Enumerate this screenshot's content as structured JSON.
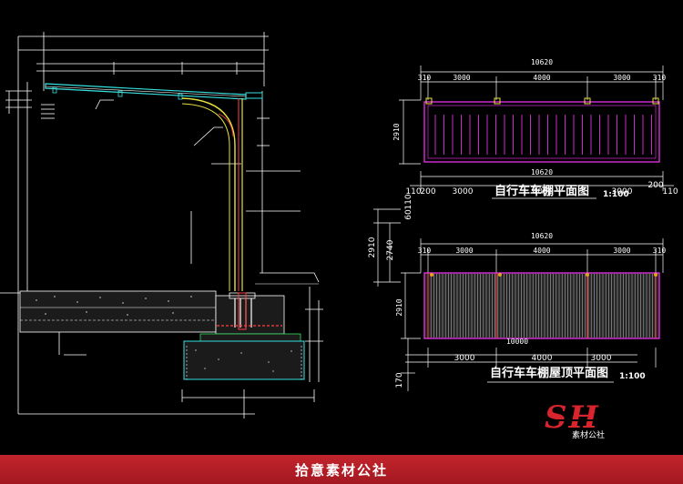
{
  "plan_view": {
    "title": "自行车车棚平面图",
    "scale": "1:100",
    "total_top": "10620",
    "segments_top": [
      "310",
      "3000",
      "4000",
      "3000",
      "310"
    ],
    "height": "2910",
    "total_bottom": "10620",
    "segments_bottom": [
      "110",
      "200",
      "3000",
      "4000",
      "3000",
      "200",
      "110"
    ]
  },
  "roof_view": {
    "title": "自行车车棚屋顶平面图",
    "scale": "1:100",
    "total_top": "10620",
    "segments_top": [
      "310",
      "3000",
      "4000",
      "3000",
      "310"
    ],
    "height": "2910",
    "inner_width": "10000",
    "segments_bottom": [
      "3000",
      "4000",
      "3000"
    ],
    "side_dims": [
      "2910",
      "2740",
      "60",
      "110",
      "170"
    ]
  },
  "logo": {
    "mark": "SH",
    "caption": "素材公社"
  },
  "footer": {
    "text": "拾意素材公社"
  },
  "colors": {
    "background": "#000000",
    "footer": "#c2242c",
    "magenta": "#ff33ff",
    "yellow": "#e8e040",
    "cyan": "#36e0e0",
    "green": "#30e060"
  }
}
